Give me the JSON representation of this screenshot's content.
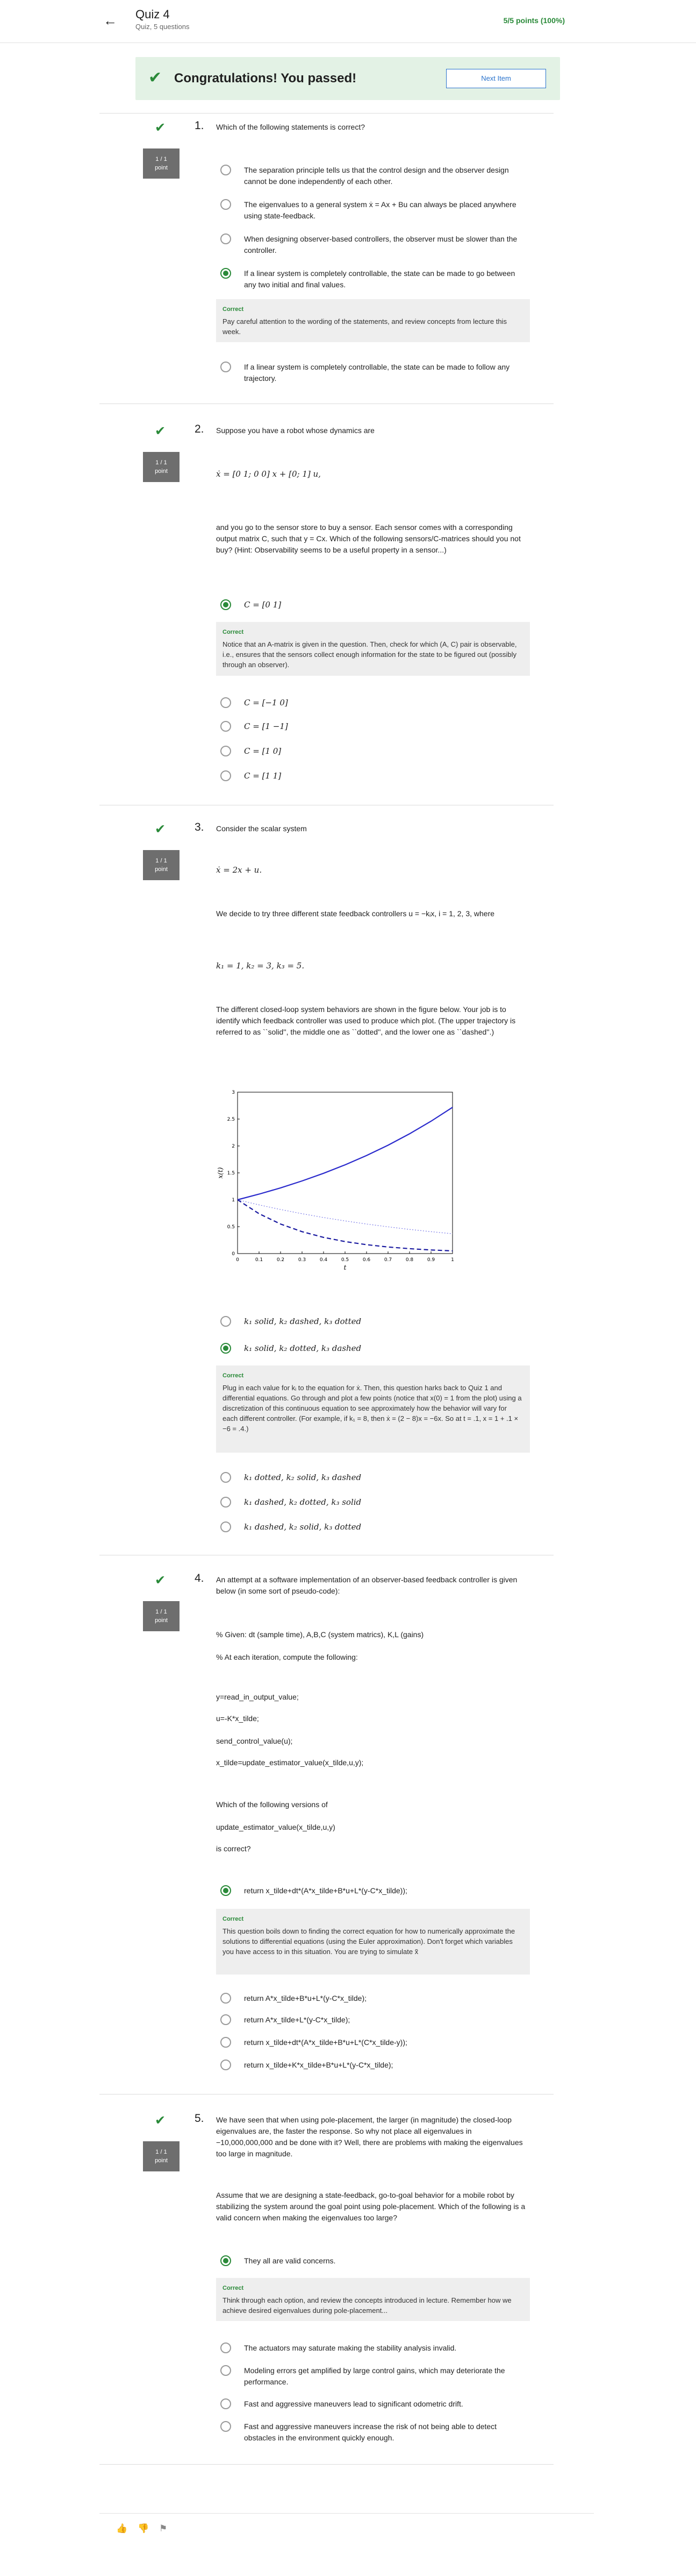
{
  "header": {
    "title": "Quiz 4",
    "subtitle": "Quiz, 5 questions",
    "score": "5/5 points (100%)"
  },
  "banner": {
    "title": "Congratulations! You passed!",
    "next_label": "Next Item"
  },
  "q1": {
    "num": "1.",
    "points": "1 / 1\npoint",
    "text": "Which of the following statements is correct?",
    "opts": [
      "The separation principle tells us that the control design and the observer design cannot be done independently of each other.",
      "The eigenvalues to a general system ẋ = Ax + Bu can always be placed anywhere using state-feedback.",
      "When designing observer-based controllers, the observer must be slower than the controller.",
      "If a linear system is completely controllable, the state can be made to go between any two initial and final values.",
      "If a linear system is completely controllable, the state can be made to follow any trajectory."
    ],
    "fb_label": "Correct",
    "fb": "Pay careful attention to the wording of the statements, and review concepts from lecture this week."
  },
  "q2": {
    "num": "2.",
    "points": "1 / 1\npoint",
    "text": "Suppose you have a robot whose dynamics are",
    "eq": "ẋ = [0 1; 0 0] x + [0; 1] u,",
    "text2": "and you go to the sensor store to buy a sensor. Each sensor comes with a corresponding output matrix C, such that y = Cx. Which of the following sensors/C-matrices should you not buy? (Hint: Observability seems to be a useful property in a sensor...)",
    "opts": [
      "C = [0   1]",
      "C = [−1   0]",
      "C = [1   −1]",
      "C = [1   0]",
      "C = [1   1]"
    ],
    "fb_label": "Correct",
    "fb": "Notice that an A-matrix is given in the question. Then, check for which (A, C) pair is observable, i.e., ensures that the sensors collect enough information for the state to be figured out (possibly through an observer)."
  },
  "q3": {
    "num": "3.",
    "points": "1 / 1\npoint",
    "text": "Consider the scalar system",
    "eq": "ẋ = 2x + u.",
    "text2": "We decide to try three different state feedback controllers u = −kᵢx, i = 1, 2, 3, where",
    "eq2": "k₁ = 1,  k₂ = 3,  k₃ = 5.",
    "text3": "The different closed-loop system behaviors are shown in the figure below. Your job is to identify which feedback controller was used to produce which plot. (The upper trajectory is referred to as ``solid'', the middle one as ``dotted'', and the lower one as ``dashed''.)",
    "opts": [
      "k₁ solid, k₂ dashed, k₃ dotted",
      "k₁ solid, k₂ dotted, k₃ dashed",
      "k₁ dotted, k₂ solid, k₃ dashed",
      "k₁ dashed, k₂ dotted, k₃ solid",
      "k₁ dashed, k₂ solid, k₃ dotted"
    ],
    "fb_label": "Correct",
    "fb": "Plug in each value for kᵢ to the equation for ẋ. Then, this question harks back to Quiz 1 and differential equations. Go through and plot a few points (notice that x(0) = 1 from the plot) using a discretization of this continuous equation to see approximately how the behavior will vary for each different controller. (For example, if k₁ = 8, then ẋ = (2 − 8)x = −6x. So at t = .1, x = 1 + .1 × −6 = .4.)"
  },
  "chart_data": {
    "type": "line",
    "x": [
      0,
      0.1,
      0.2,
      0.3,
      0.4,
      0.5,
      0.6,
      0.7,
      0.8,
      0.9,
      1
    ],
    "series": [
      {
        "style": "solid",
        "values": [
          1,
          1.105,
          1.221,
          1.35,
          1.492,
          1.649,
          1.822,
          2.014,
          2.226,
          2.46,
          2.718
        ]
      },
      {
        "style": "dotted",
        "values": [
          1,
          0.905,
          0.819,
          0.741,
          0.67,
          0.607,
          0.549,
          0.497,
          0.449,
          0.407,
          0.368
        ]
      },
      {
        "style": "dashed",
        "values": [
          1,
          0.741,
          0.549,
          0.407,
          0.301,
          0.223,
          0.165,
          0.122,
          0.091,
          0.067,
          0.05
        ]
      }
    ],
    "xlabel": "t",
    "ylabel": "x(t)",
    "xlim": [
      0,
      1
    ],
    "ylim": [
      0,
      3
    ],
    "xticks": [
      "0",
      "0.1",
      "0.2",
      "0.3",
      "0.4",
      "0.5",
      "0.6",
      "0.7",
      "0.8",
      "0.9",
      "1"
    ],
    "yticks": [
      "0",
      "0.5",
      "1",
      "1.5",
      "2",
      "2.5",
      "3"
    ]
  },
  "q4": {
    "num": "4.",
    "points": "1 / 1\npoint",
    "text": "An attempt at a software implementation of an observer-based feedback controller is given below (in some sort of pseudo-code):",
    "code": [
      "% Given: dt (sample time), A,B,C (system matrics), K,L (gains)",
      "% At each iteration, compute the following:",
      "y=read_in_output_value;",
      "u=-K*x_tilde;",
      "send_control_value(u);",
      "x_tilde=update_estimator_value(x_tilde,u,y);"
    ],
    "text2": "Which of the following versions of",
    "text3": "update_estimator_value(x_tilde,u,y)",
    "text4": "is correct?",
    "opts": [
      "return x_tilde+dt*(A*x_tilde+B*u+L*(y-C*x_tilde));",
      "return A*x_tilde+B*u+L*(y-C*x_tilde);",
      "return A*x_tilde+L*(y-C*x_tilde);",
      "return x_tilde+dt*(A*x_tilde+B*u+L*(C*x_tilde-y));",
      "return x_tilde+K*x_tilde+B*u+L*(y-C*x_tilde);"
    ],
    "fb_label": "Correct",
    "fb": "This question boils down to finding the correct equation for how to numerically approximate the solutions to differential equations (using the Euler approximation). Don't forget which variables you have access to in this situation. You are trying to simulate x̃"
  },
  "q5": {
    "num": "5.",
    "points": "1 / 1\npoint",
    "text": "We have seen that when using pole-placement, the larger (in magnitude) the closed-loop eigenvalues are, the faster the response. So why not place all eigenvalues in −10,000,000,000 and be done with it? Well, there are problems with making the eigenvalues too large in magnitude.",
    "text2": "Assume that we are designing a state-feedback, go-to-goal behavior for a mobile robot by stabilizing the system around the goal point using pole-placement. Which of the following is a valid concern when making the eigenvalues too large?",
    "opts": [
      "They all are valid concerns.",
      "The actuators may saturate making the stability analysis invalid.",
      "Modeling errors get amplified by large control gains, which may deteriorate the performance.",
      "Fast and aggressive maneuvers lead to significant odometric drift.",
      "Fast and aggressive maneuvers increase the risk of not being able to detect obstacles in the environment quickly enough."
    ],
    "fb_label": "Correct",
    "fb": "Think through each option, and review the concepts introduced in lecture. Remember how we achieve desired eigenvalues during pole-placement..."
  },
  "footer": {
    "like": "👍",
    "dislike": "👎",
    "flag": "⚑"
  }
}
